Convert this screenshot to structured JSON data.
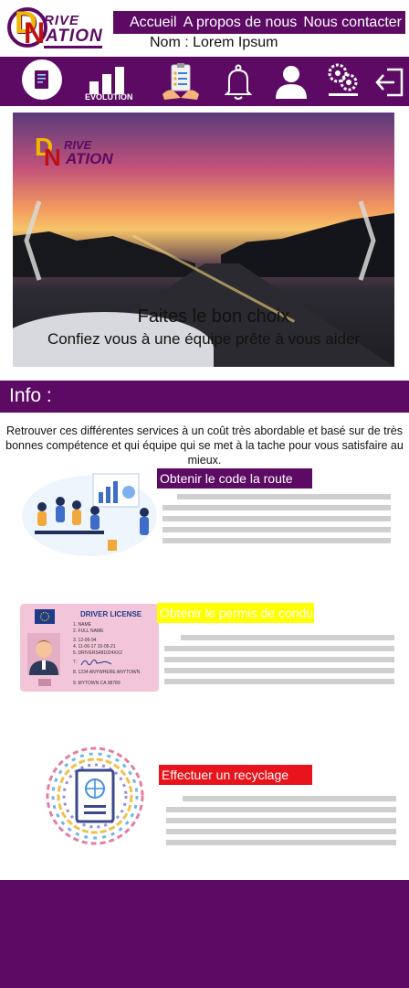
{
  "brand": {
    "logo_d": "D",
    "logo_n": "N",
    "logo_top": "RIVE",
    "logo_bottom": "ATION"
  },
  "nav": {
    "items": [
      "Accueil",
      "A propos de nous",
      "Nous contacter"
    ]
  },
  "user": {
    "name_label": "Nom : Lorem Ipsum"
  },
  "iconbar": {
    "icons": [
      "document-icon",
      "evolution-chart-icon",
      "checklist-icon",
      "bell-icon",
      "user-icon",
      "settings-gear-icon",
      "logout-icon"
    ],
    "evolution_label": "EVOLUTION"
  },
  "hero": {
    "caption_title": "Faites le bon choix",
    "caption_subtitle": "Confiez vous à une équipe prête à vous aider"
  },
  "info": {
    "title": "Info :",
    "intro": "Retrouver ces différentes services à un coût très abordable et basé sur de très bonnes compétence et qui équipe qui se met à la tache pour vous satisfaire au mieux."
  },
  "services": [
    {
      "title": "Obtenir le code la route",
      "title_bg": "#5c0a63",
      "title_color": "#ffffff"
    },
    {
      "title": "Obtenir le permis de conduire",
      "title_bg": "#ffff00",
      "title_color": "#ffffff"
    },
    {
      "title": "Effectuer un recyclage",
      "title_bg": "#e8131b",
      "title_color": "#ffffff"
    }
  ],
  "license_card": {
    "header": "DRIVER LICENSE",
    "lines": [
      "1. NAME",
      "2. FULL NAME",
      "3. 12-06-94",
      "4. 11-06-17   10-05-21",
      "5. DRIVERS481024XX2",
      "7.",
      "8. 1234 ANYWHERE ANYTOWN",
      "9. MYTOWN CA 98789"
    ]
  },
  "colors": {
    "brand_purple": "#5c0a63",
    "accent_yellow": "#f0b800",
    "accent_red": "#c01010",
    "placeholder_grey": "#cfcfcf"
  }
}
